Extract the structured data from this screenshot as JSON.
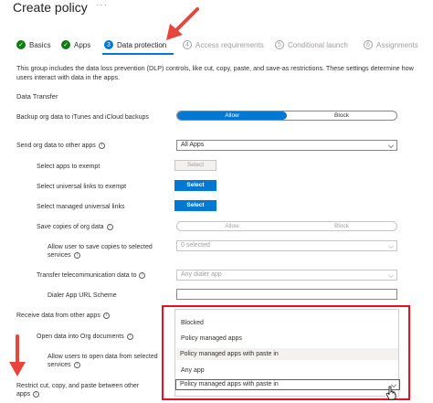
{
  "page_title": "Create policy",
  "title_more": "···",
  "steps": [
    {
      "num": "✓",
      "label": "Basics",
      "state": "done"
    },
    {
      "num": "✓",
      "label": "Apps",
      "state": "done"
    },
    {
      "num": "3",
      "label": "Data protection",
      "state": "active"
    },
    {
      "num": "4",
      "label": "Access requirements",
      "state": "pending"
    },
    {
      "num": "5",
      "label": "Conditional launch",
      "state": "pending"
    },
    {
      "num": "6",
      "label": "Assignments",
      "state": "pending"
    }
  ],
  "description": "This group includes the data loss prevention (DLP) controls, like cut, copy, paste, and save-as restrictions. These settings determine how users interact with data in the apps.",
  "section_heading": "Data Transfer",
  "rows": {
    "backup_label": "Backup org data to iTunes and iCloud backups",
    "backup_allow": "Allow",
    "backup_block": "Block",
    "send_label": "Send org data to other apps",
    "send_value": "All Apps",
    "exempt_label": "Select apps to exempt",
    "exempt_btn": "Select",
    "universal_label": "Select universal links to exempt",
    "universal_btn": "Select",
    "managed_label": "Select managed universal links",
    "managed_btn": "Select",
    "copies_label": "Save copies of org data",
    "copies_allow": "Allow",
    "copies_block": "Block",
    "allow_save_label": "Allow user to save copies to selected services",
    "allow_save_value": "0 selected",
    "telecom_label": "Transfer telecommunication data to",
    "telecom_value": "Any dialer app",
    "dialer_label": "Dialer App URL Scheme",
    "receive_label": "Receive data from other apps",
    "open_into_label": "Open data into Org documents",
    "allow_open_label": "Allow users to open data from selected services",
    "restrict_label": "Restrict cut, copy, and paste between other apps",
    "restrict_value": "Policy managed apps with paste in"
  },
  "dropdown_options": [
    "Blocked",
    "Policy managed apps",
    "Policy managed apps with paste in",
    "Any app"
  ],
  "colors": {
    "accent": "#0078d4",
    "success": "#107c10",
    "highlight": "#e81123"
  }
}
